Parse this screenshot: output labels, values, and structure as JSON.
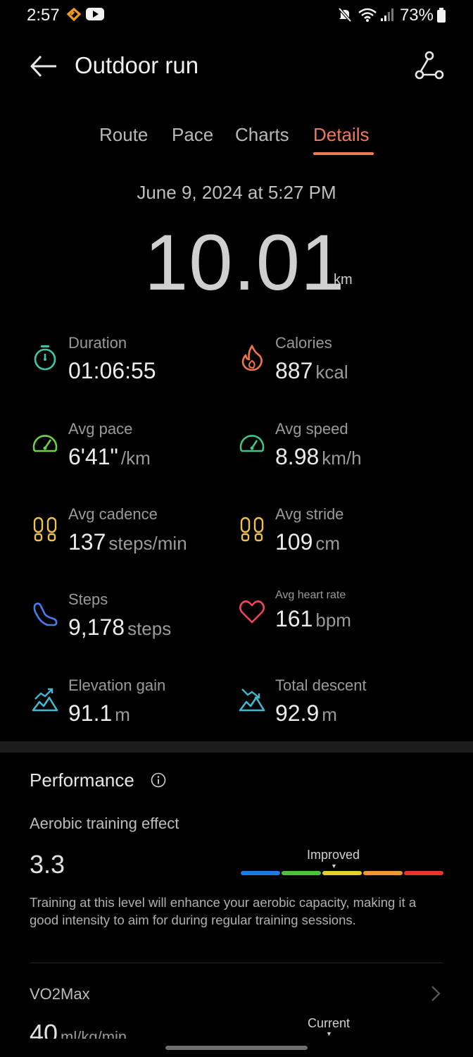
{
  "status_bar": {
    "time": "2:57",
    "battery": "73%"
  },
  "header": {
    "title": "Outdoor run"
  },
  "tabs": [
    {
      "label": "Route"
    },
    {
      "label": "Pace"
    },
    {
      "label": "Charts"
    },
    {
      "label": "Details",
      "active": true
    }
  ],
  "summary": {
    "date": "June 9, 2024 at 5:27 PM",
    "distance": "10.01",
    "distance_unit": "km"
  },
  "metrics": {
    "duration": {
      "label": "Duration",
      "value": "01:06:55",
      "unit": ""
    },
    "calories": {
      "label": "Calories",
      "value": "887",
      "unit": "kcal"
    },
    "avg_pace": {
      "label": "Avg pace",
      "value": "6'41\"",
      "unit": "/km"
    },
    "avg_speed": {
      "label": "Avg speed",
      "value": "8.98",
      "unit": "km/h"
    },
    "avg_cadence": {
      "label": "Avg cadence",
      "value": "137",
      "unit": "steps/min"
    },
    "avg_stride": {
      "label": "Avg stride",
      "value": "109",
      "unit": "cm"
    },
    "steps": {
      "label": "Steps",
      "value": "9,178",
      "unit": "steps"
    },
    "avg_heart_rate": {
      "label": "Avg heart rate",
      "value": "161",
      "unit": "bpm"
    },
    "elevation_gain": {
      "label": "Elevation gain",
      "value": "91.1",
      "unit": "m"
    },
    "total_descent": {
      "label": "Total descent",
      "value": "92.9",
      "unit": "m"
    }
  },
  "performance": {
    "title": "Performance",
    "aerobic": {
      "label": "Aerobic training effect",
      "value": "3.3",
      "level_label": "Improved",
      "description": "Training at this level will enhance your aerobic capacity, making it a good intensity to aim for during regular training sessions.",
      "scale_colors": [
        "#1e7be0",
        "#4cc23b",
        "#e0d12b",
        "#f0962e",
        "#e8352a"
      ]
    },
    "vo2max": {
      "label": "VO2Max",
      "value": "40",
      "unit": "ml/kg/min",
      "marker_label": "Current"
    }
  },
  "colors": {
    "accent": "#f07a57"
  }
}
